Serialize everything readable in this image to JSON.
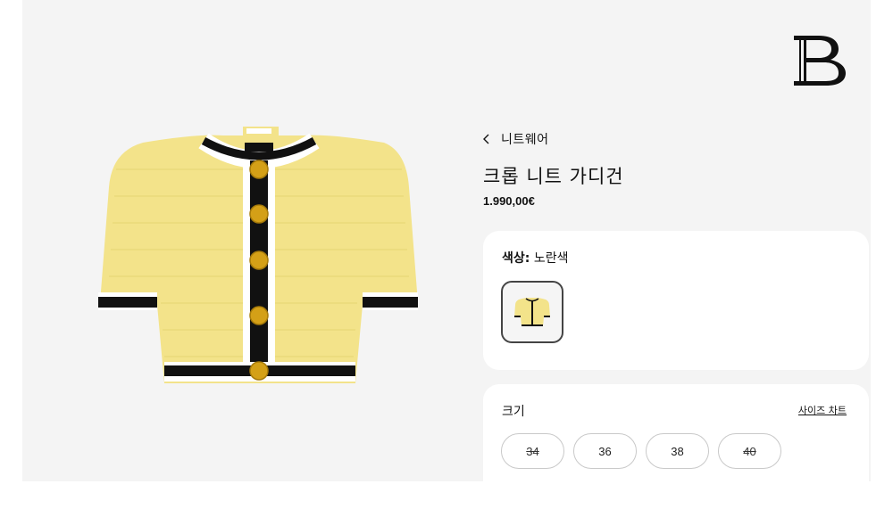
{
  "breadcrumb": {
    "label": "니트웨어"
  },
  "product": {
    "title": "크롭 니트 가디건",
    "price": "1.990,00€"
  },
  "color": {
    "label": "색상:",
    "value": "노란색"
  },
  "size": {
    "label": "크기",
    "chart_link": "사이즈 차트",
    "options": [
      {
        "label": "34",
        "available": false
      },
      {
        "label": "36",
        "available": true
      },
      {
        "label": "38",
        "available": true
      },
      {
        "label": "40",
        "available": false
      }
    ]
  },
  "colors": {
    "background": "#f4f4f4",
    "card": "#ffffff",
    "garment": "#f3e38a",
    "trim_black": "#111111",
    "button_gold": "#d4a017"
  }
}
